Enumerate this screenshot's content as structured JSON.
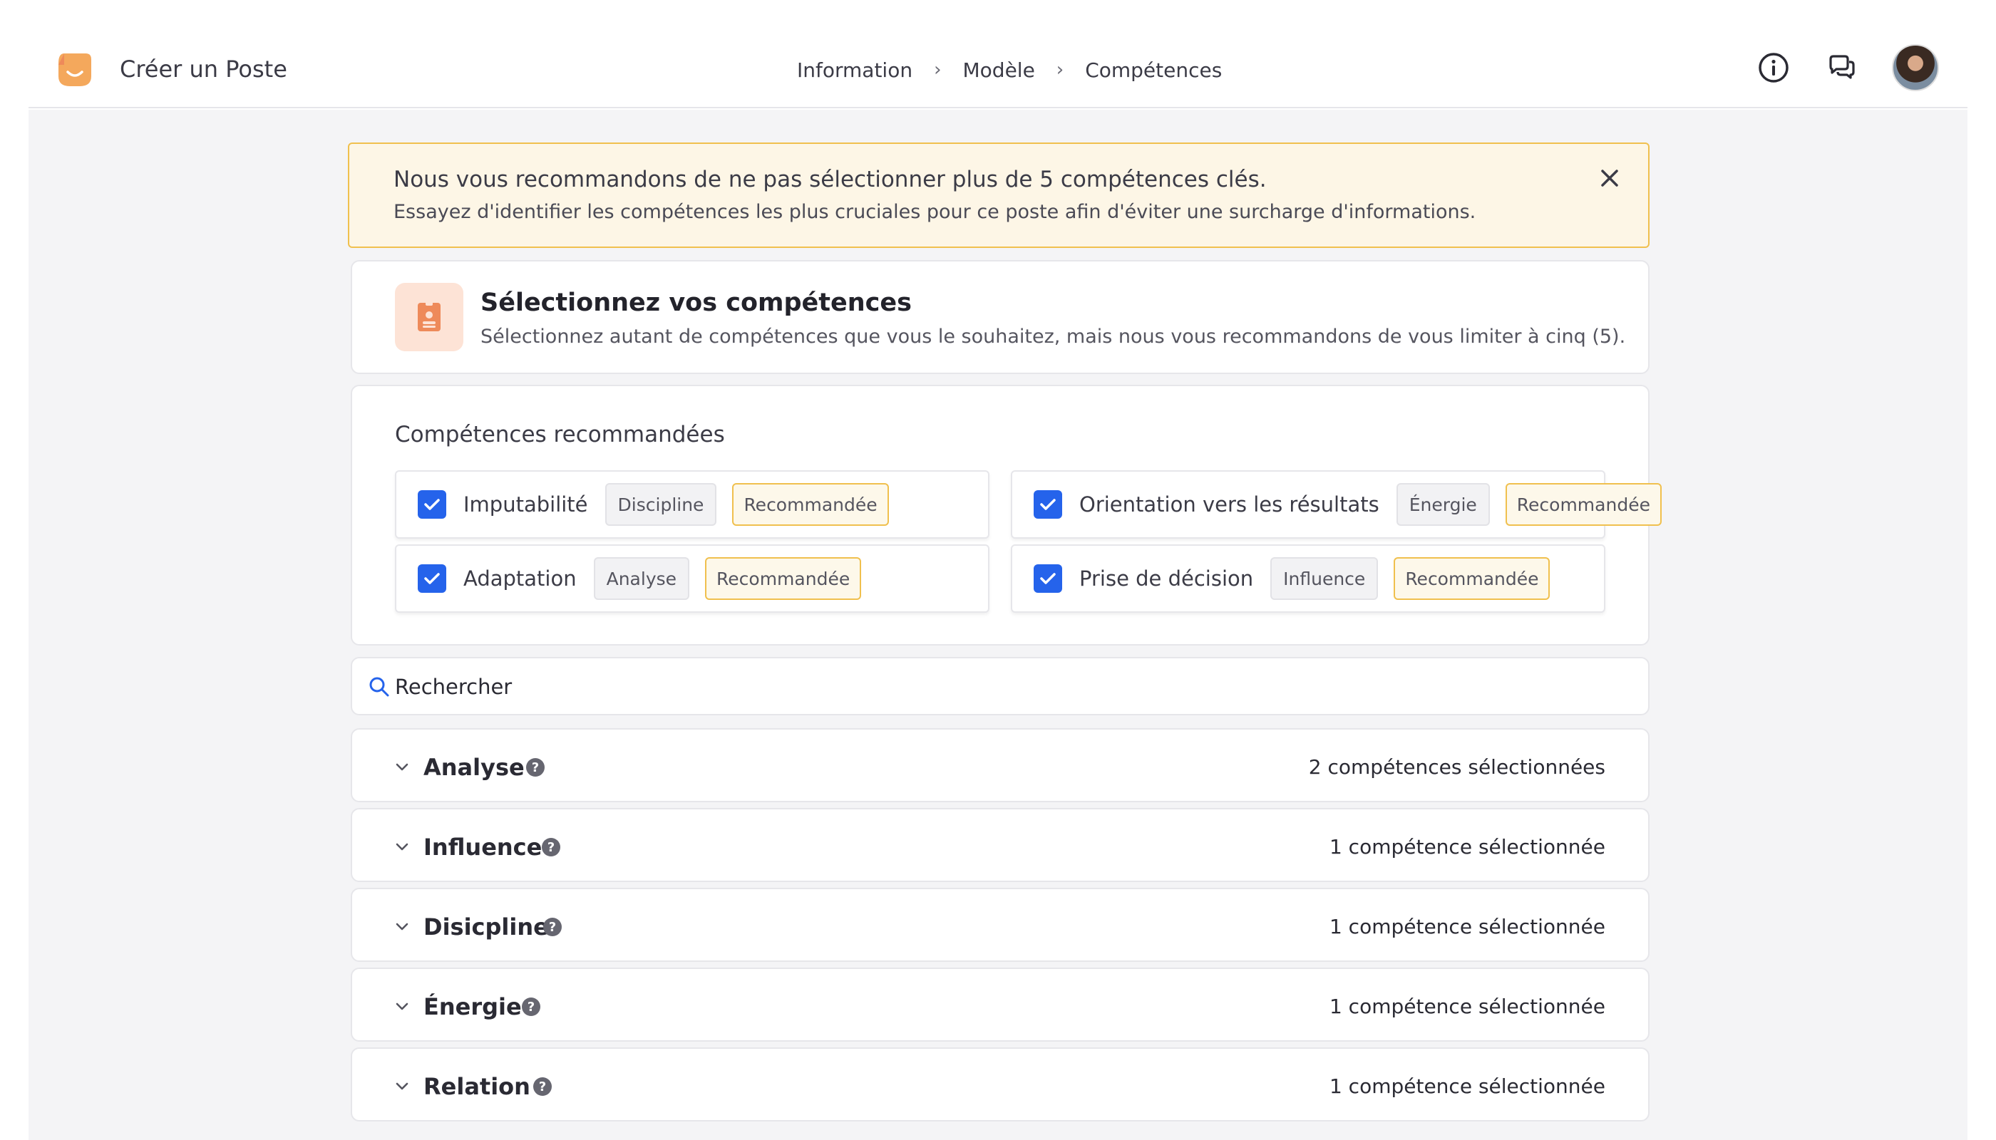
{
  "header": {
    "app_title": "Créer un Poste",
    "breadcrumb": [
      "Information",
      "Modèle",
      "Compétences"
    ],
    "separator": "›",
    "icons": [
      "info-icon",
      "chat-icon",
      "avatar"
    ]
  },
  "alert": {
    "title": "Nous vous recommandons de ne pas sélectionner plus de 5 compétences clés.",
    "description": "Essayez d'identifier les compétences les plus cruciales pour ce poste afin d'éviter une surcharge d'informations."
  },
  "section": {
    "title": "Sélectionnez vos compétences",
    "subtitle": "Sélectionnez autant de compétences que vous le souhaitez, mais nous vous recommandons de vous limiter à cinq (5)."
  },
  "recommended": {
    "title": "Compétences recommandées",
    "items": [
      {
        "label": "Imputabilité",
        "category": "Discipline",
        "badge": "Recommandée",
        "checked": true
      },
      {
        "label": "Orientation vers les résultats",
        "category": "Énergie",
        "badge": "Recommandée",
        "checked": true
      },
      {
        "label": "Adaptation",
        "category": "Analyse",
        "badge": "Recommandée",
        "checked": true
      },
      {
        "label": "Prise de décision",
        "category": "Influence",
        "badge": "Recommandée",
        "checked": true
      }
    ]
  },
  "search": {
    "placeholder": "Rechercher"
  },
  "categories": [
    {
      "name": "Analyse",
      "count": "2 compétences sélectionnées"
    },
    {
      "name": "Influence",
      "count": "1 compétence sélectionnée"
    },
    {
      "name": "Disicpline",
      "count": "1 compétence sélectionnée"
    },
    {
      "name": "Énergie",
      "count": "1 compétence sélectionnée"
    },
    {
      "name": "Relation",
      "count": "1 compétence sélectionnée"
    }
  ],
  "colors": {
    "accent": "#2563eb",
    "brand": "#f4a85c",
    "alert_border": "#f0c04e",
    "alert_bg": "#fdf6e6",
    "icon_bg": "#fde3d6",
    "icon_fg": "#ee8a5a"
  }
}
